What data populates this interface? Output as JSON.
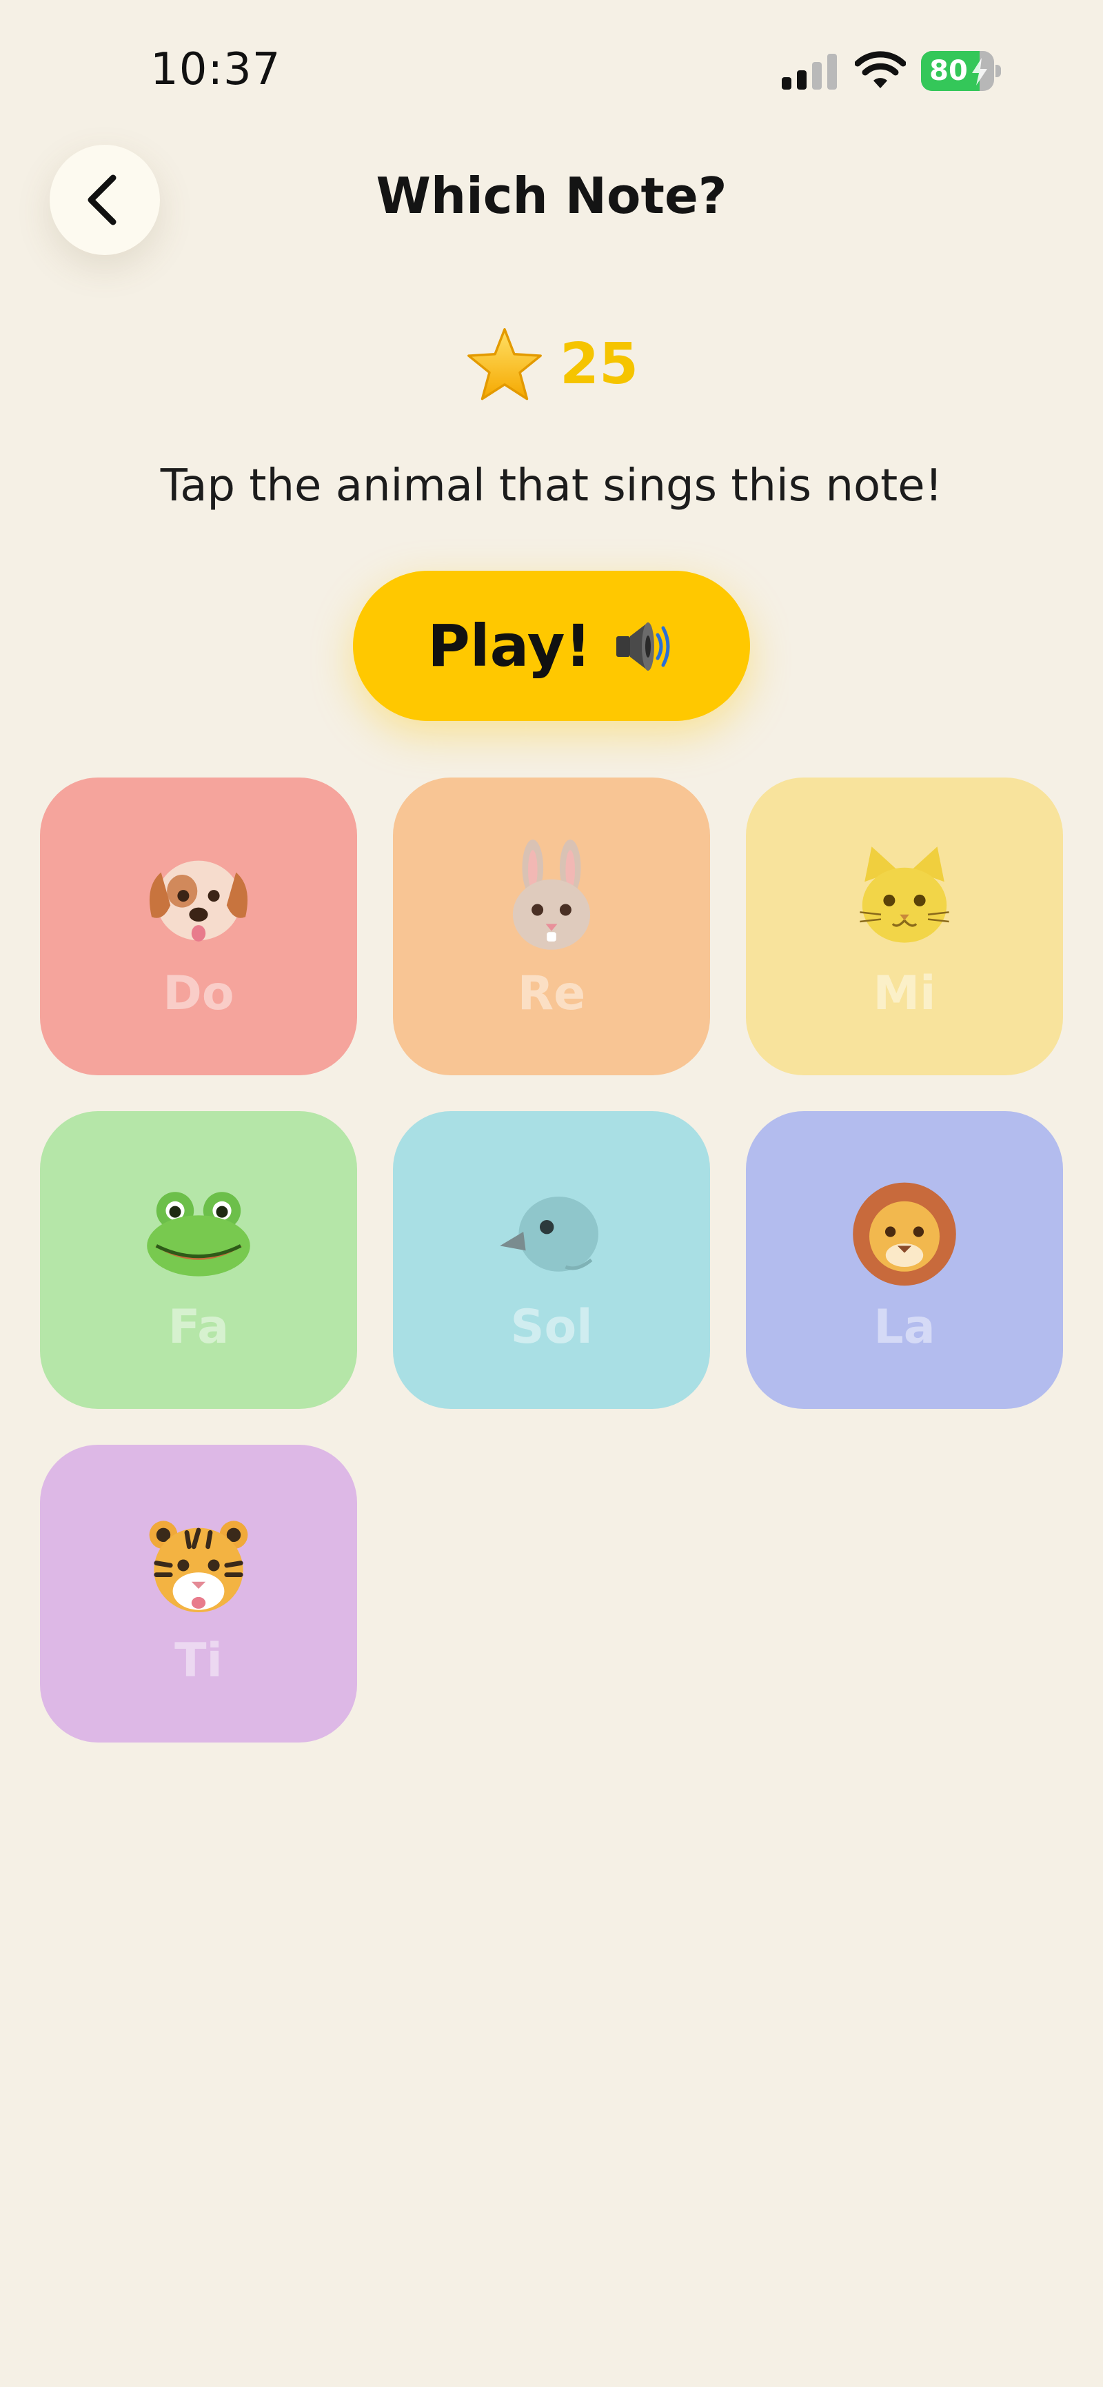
{
  "status_bar": {
    "time": "10:37",
    "battery_level": "80",
    "battery_charging": true,
    "signal_bars_active": 2,
    "signal_bars_total": 4,
    "icons": [
      "signal-icon",
      "wifi-icon",
      "battery-icon"
    ]
  },
  "header": {
    "back_icon": "chevron-left-icon",
    "title": "Which Note?"
  },
  "score": {
    "icon": "star-icon",
    "value": "25"
  },
  "instruction": "Tap the animal that sings this note!",
  "play_button": {
    "label": "Play!",
    "icon": "speaker-icon",
    "color": "#ffc800"
  },
  "notes": [
    {
      "label": "Do",
      "animal": "dog-face-icon",
      "color": "#f5a49c"
    },
    {
      "label": "Re",
      "animal": "rabbit-face-icon",
      "color": "#f8c594"
    },
    {
      "label": "Mi",
      "animal": "cat-face-icon",
      "color": "#f8e39c"
    },
    {
      "label": "Fa",
      "animal": "frog-face-icon",
      "color": "#b5e6a8"
    },
    {
      "label": "Sol",
      "animal": "bird-face-icon",
      "color": "#a9dfe4"
    },
    {
      "label": "La",
      "animal": "lion-face-icon",
      "color": "#b3bcee"
    },
    {
      "label": "Ti",
      "animal": "tiger-face-icon",
      "color": "#ddb8e6"
    }
  ],
  "colors": {
    "background": "#f5f0e5",
    "score_text": "#f5c400",
    "battery": "#34c759"
  }
}
